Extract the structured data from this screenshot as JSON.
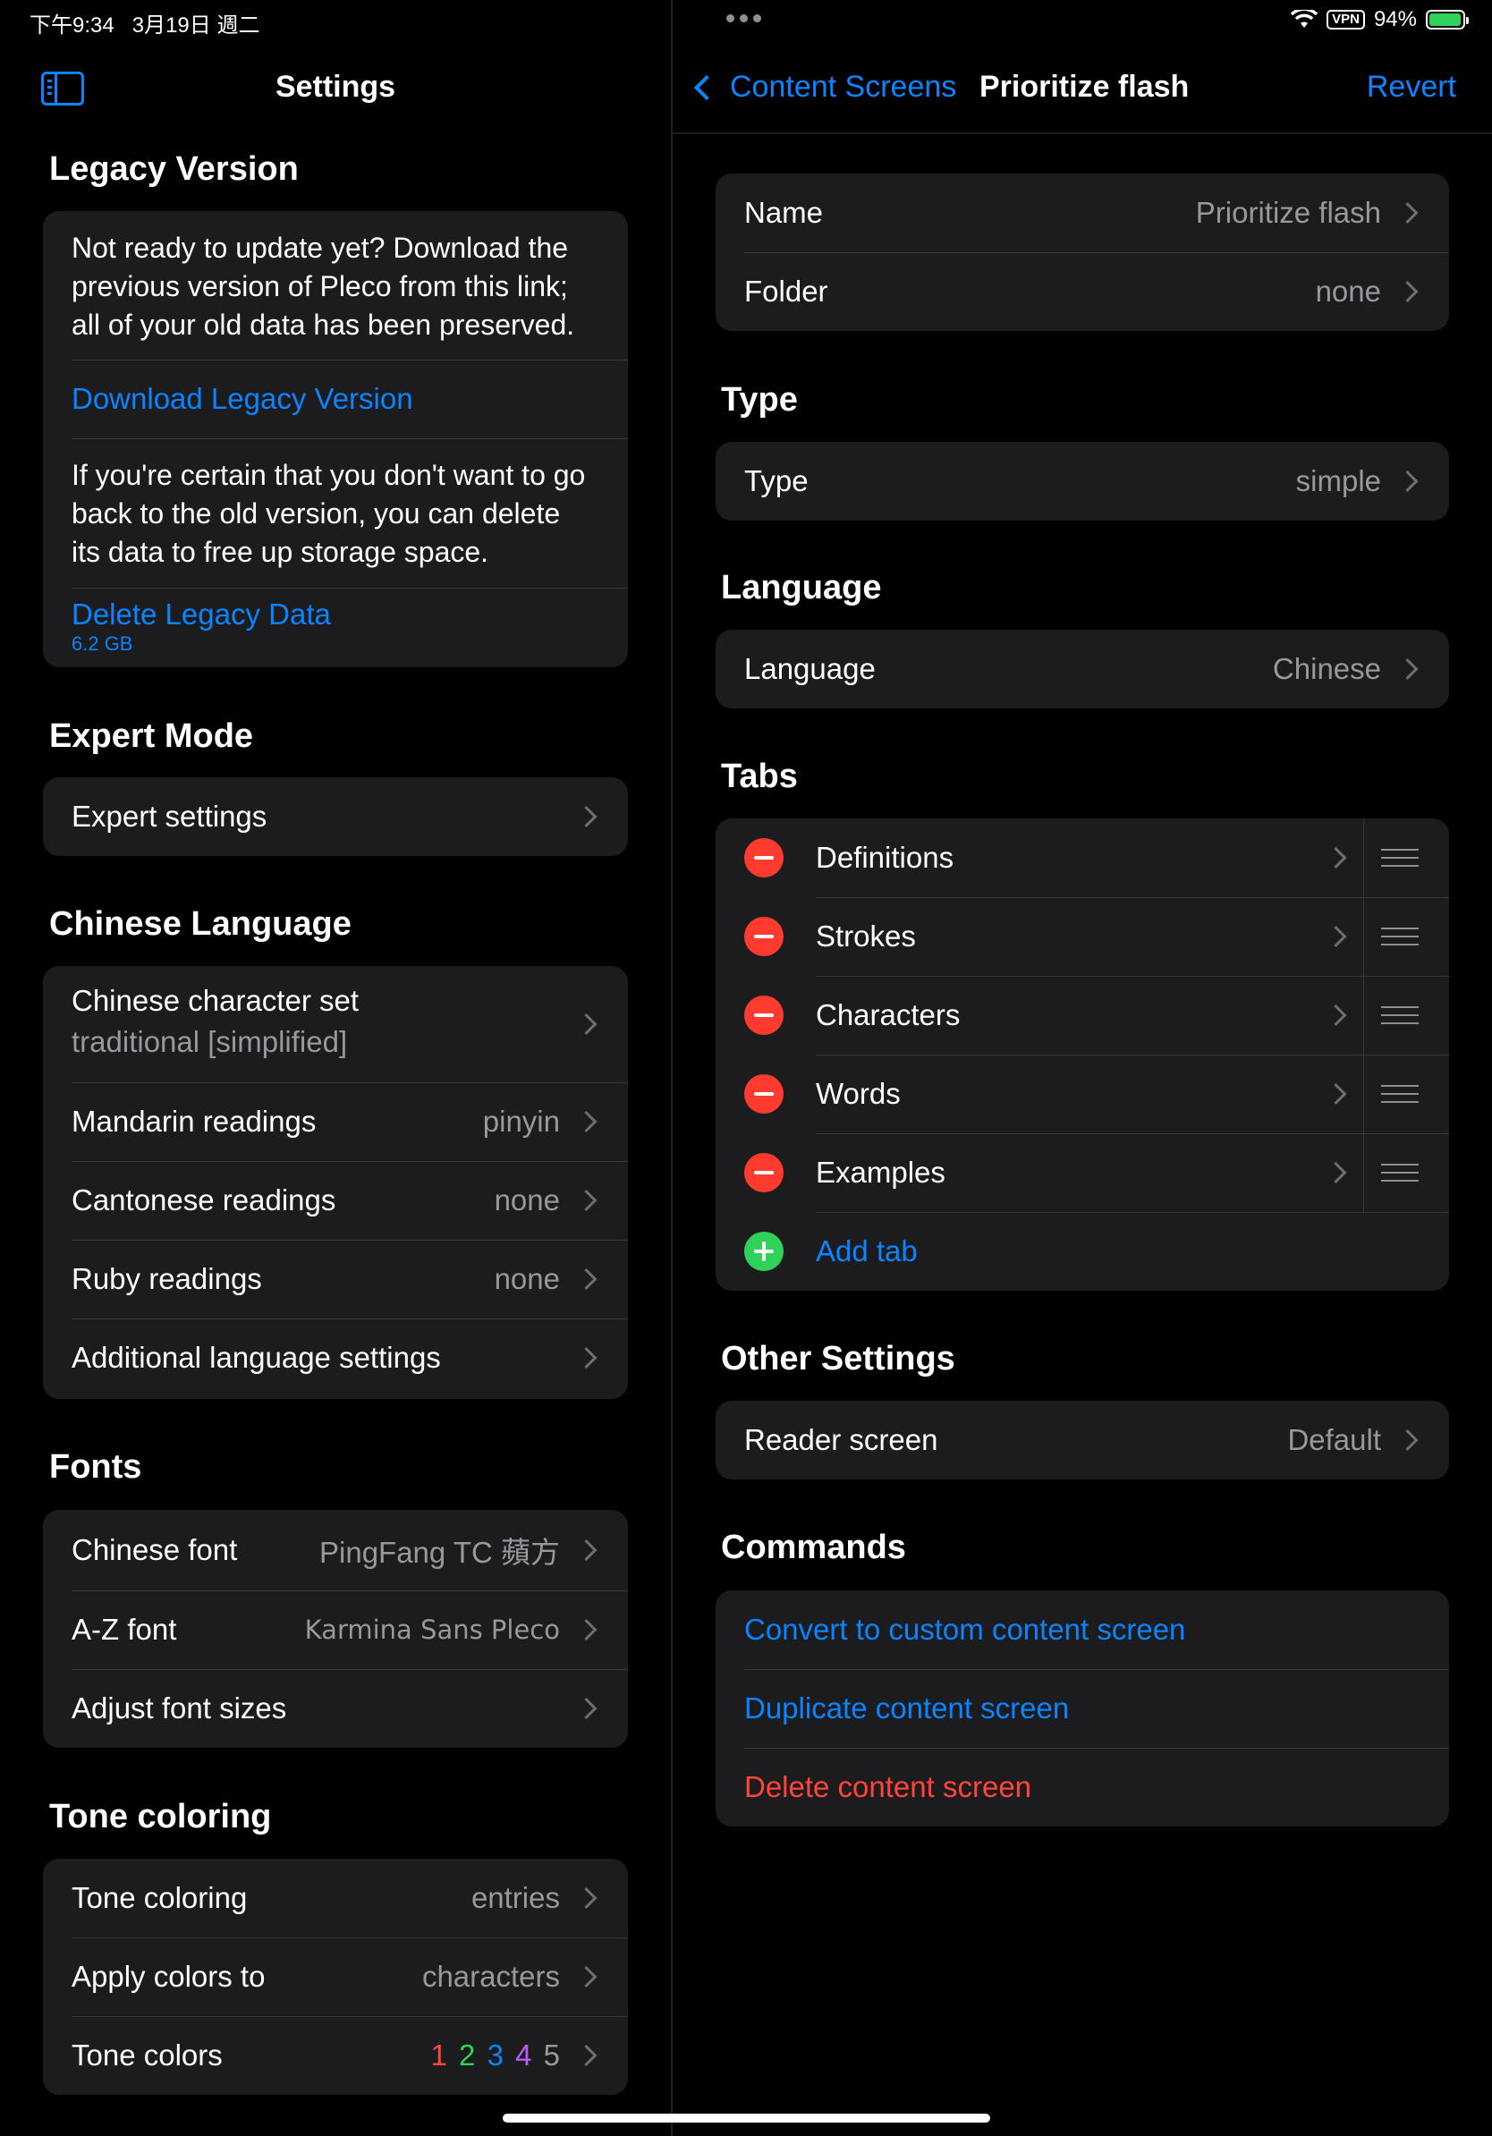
{
  "status": {
    "time": "下午9:34",
    "date": "3月19日 週二",
    "vpn": "VPN",
    "battery": "94%"
  },
  "left": {
    "title": "Settings",
    "legacy": {
      "header": "Legacy Version",
      "intro": "Not ready to update yet? Download the previous version of Pleco from this link; all of your old data has been preserved.",
      "download": "Download Legacy Version",
      "delete_info": "If you're certain that you don't want to go back to the old version, you can delete its data to free up storage space.",
      "delete": "Delete Legacy Data",
      "size": "6.2 GB"
    },
    "expert": {
      "header": "Expert Mode",
      "settings": "Expert settings"
    },
    "chinese": {
      "header": "Chinese Language",
      "charset_label": "Chinese character set",
      "charset_value": "traditional [simplified]",
      "mandarin_label": "Mandarin readings",
      "mandarin_value": "pinyin",
      "cantonese_label": "Cantonese readings",
      "cantonese_value": "none",
      "ruby_label": "Ruby readings",
      "ruby_value": "none",
      "additional": "Additional language settings"
    },
    "fonts": {
      "header": "Fonts",
      "chinese_label": "Chinese font",
      "chinese_value": "PingFang TC 蘋方",
      "az_label": "A-Z font",
      "az_value": "Karmina Sans Pleco",
      "adjust": "Adjust font sizes"
    },
    "tone": {
      "header": "Tone coloring",
      "coloring_label": "Tone coloring",
      "coloring_value": "entries",
      "apply_label": "Apply colors to",
      "apply_value": "characters",
      "colors_label": "Tone colors",
      "tones": [
        "1",
        "2",
        "3",
        "4",
        "5"
      ],
      "tone_colors": [
        "#ff453a",
        "#30d158",
        "#0a84ff",
        "#bf5af2",
        "#98989d"
      ]
    }
  },
  "right": {
    "back_label": "Content Screens",
    "title": "Prioritize flash",
    "revert": "Revert",
    "name_label": "Name",
    "name_value": "Prioritize flash",
    "folder_label": "Folder",
    "folder_value": "none",
    "type_header": "Type",
    "type_label": "Type",
    "type_value": "simple",
    "language_header": "Language",
    "language_label": "Language",
    "language_value": "Chinese",
    "tabs_header": "Tabs",
    "tabs": [
      "Definitions",
      "Strokes",
      "Characters",
      "Words",
      "Examples"
    ],
    "add_tab": "Add tab",
    "other_header": "Other Settings",
    "reader_label": "Reader screen",
    "reader_value": "Default",
    "commands_header": "Commands",
    "convert": "Convert to custom content screen",
    "duplicate": "Duplicate content screen",
    "delete": "Delete content screen"
  }
}
